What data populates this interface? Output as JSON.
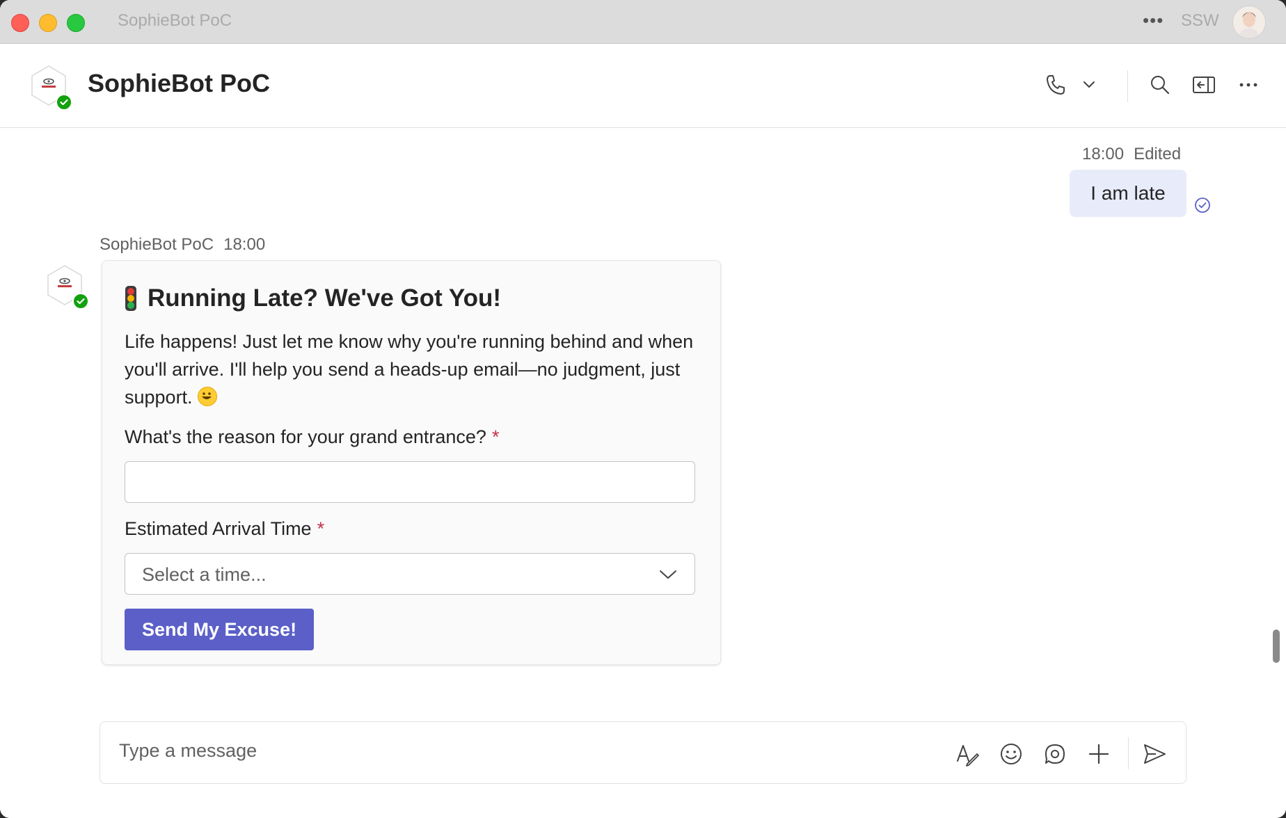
{
  "window": {
    "title": "SophieBot PoC",
    "more_label": "•••",
    "org": "SSW"
  },
  "header": {
    "title": "SophieBot PoC",
    "icons": [
      "phone-icon",
      "chevron-down-icon",
      "search-icon",
      "pop-out-icon",
      "more-icon"
    ]
  },
  "conversation": {
    "my_message": {
      "time": "18:00",
      "edited": "Edited",
      "text": "I am late"
    },
    "bot_message": {
      "sender": "SophieBot PoC",
      "time": "18:00",
      "card": {
        "title": "Running Late? We've Got You!",
        "description": "Life happens! Just let me know why you're running behind and when you'll arrive. I'll help you send a heads-up email—no judgment, just support.",
        "reason_label": "What's the reason for your grand entrance?",
        "reason_value": "",
        "arrival_label": "Estimated Arrival Time",
        "arrival_placeholder": "Select a time...",
        "required_marker": "*",
        "submit_label": "Send My Excuse!"
      }
    }
  },
  "composer": {
    "placeholder": "Type a message",
    "icons": [
      "format-icon",
      "emoji-icon",
      "loop-icon",
      "add-icon",
      "send-icon"
    ]
  },
  "colors": {
    "accent": "#5b5fc7",
    "own_bubble": "#e8ebfa",
    "presence_available": "#13a10e",
    "required": "#c4314b"
  }
}
